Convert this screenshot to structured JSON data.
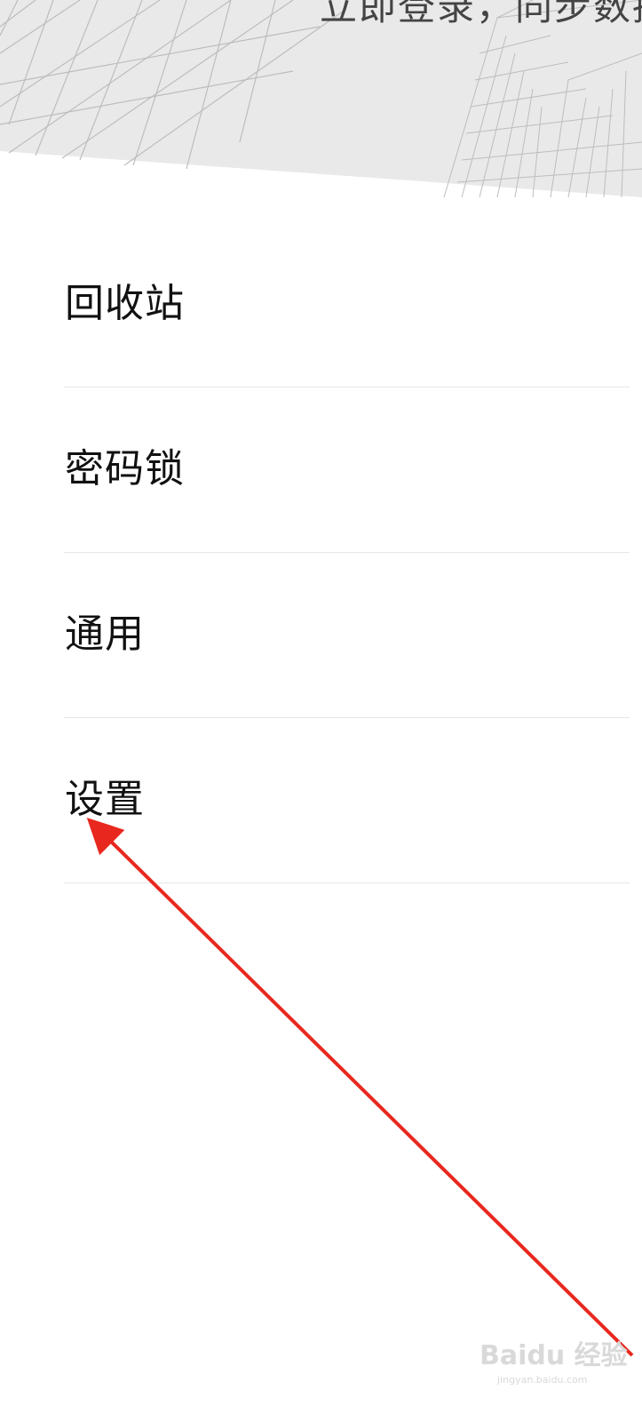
{
  "header": {
    "text": "立即登录，同步数据",
    "background_color": "#e9e9e9",
    "line_color": "#bdbdbd"
  },
  "menu": {
    "items": [
      {
        "label": "回收站"
      },
      {
        "label": "密码锁"
      },
      {
        "label": "通用"
      },
      {
        "label": "设置"
      }
    ]
  },
  "annotation": {
    "arrow_color": "#e8281e",
    "points_to": "设置"
  },
  "watermark": {
    "brand": "Baidu 经验",
    "sub": "jingyan.baidu.com"
  }
}
